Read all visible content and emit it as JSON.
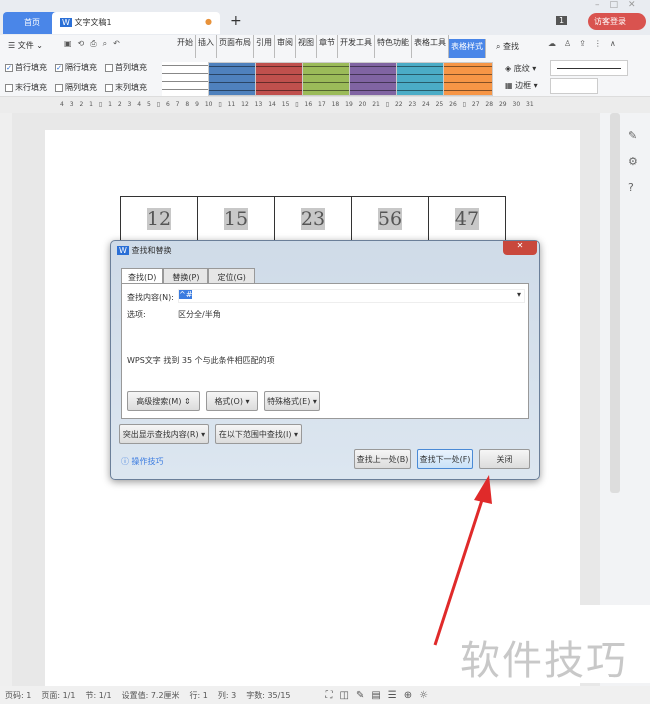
{
  "titlebar": {
    "home_tab": "首页",
    "doc_tab": "文字文稿1",
    "new_tab": "+",
    "badge": "1",
    "login": "访客登录"
  },
  "ribbon": {
    "file": "文件",
    "tabs": [
      "开始",
      "插入",
      "页面布局",
      "引用",
      "审阅",
      "视图",
      "章节",
      "开发工具",
      "特色功能",
      "表格工具",
      "表格样式"
    ],
    "search": "查找",
    "checks": [
      {
        "label": "首行填充",
        "checked": true
      },
      {
        "label": "隔行填充",
        "checked": true
      },
      {
        "label": "首列填充",
        "checked": false
      },
      {
        "label": "末行填充",
        "checked": false
      },
      {
        "label": "隔列填充",
        "checked": false
      },
      {
        "label": "末列填充",
        "checked": false
      }
    ],
    "style_colors": [
      "#ffffff",
      "#4f81bd",
      "#c0504d",
      "#9bbb59",
      "#8064a2",
      "#4bacc6",
      "#f79646"
    ],
    "shading": "底纹",
    "border": "边框"
  },
  "ruler": "4 3 2 1 ▯ 1 2 3 4 5 ▯ 6 7 8 9 10 ▯ 11 12 13 14 15 ▯ 16 17 18 19 20 21 ▯ 22 23 24 25 26 ▯ 27 28 29 30 31",
  "table": [
    "12",
    "15",
    "23",
    "56",
    "47"
  ],
  "dialog": {
    "title": "查找和替换",
    "tabs": [
      "查找(D)",
      "替换(P)",
      "定位(G)"
    ],
    "find_label": "查找内容(N):",
    "find_value": "^#",
    "options_label": "选项:",
    "options_value": "区分全/半角",
    "result": "WPS文字 找到 35 个与此条件相匹配的项",
    "adv": "高级搜索(M) ⇕",
    "format": "格式(O) ▾",
    "special": "特殊格式(E) ▾",
    "highlight": "突出显示查找内容(R) ▾",
    "range": "在以下范围中查找(I) ▾",
    "tips": "操作技巧",
    "prev": "查找上一处(B)",
    "next": "查找下一处(F)",
    "close": "关闭"
  },
  "status": [
    "页码: 1",
    "页面: 1/1",
    "节: 1/1",
    "设置值: 7.2厘米",
    "行: 1",
    "列: 3",
    "字数: 35/15"
  ],
  "watermark": "软件技巧"
}
